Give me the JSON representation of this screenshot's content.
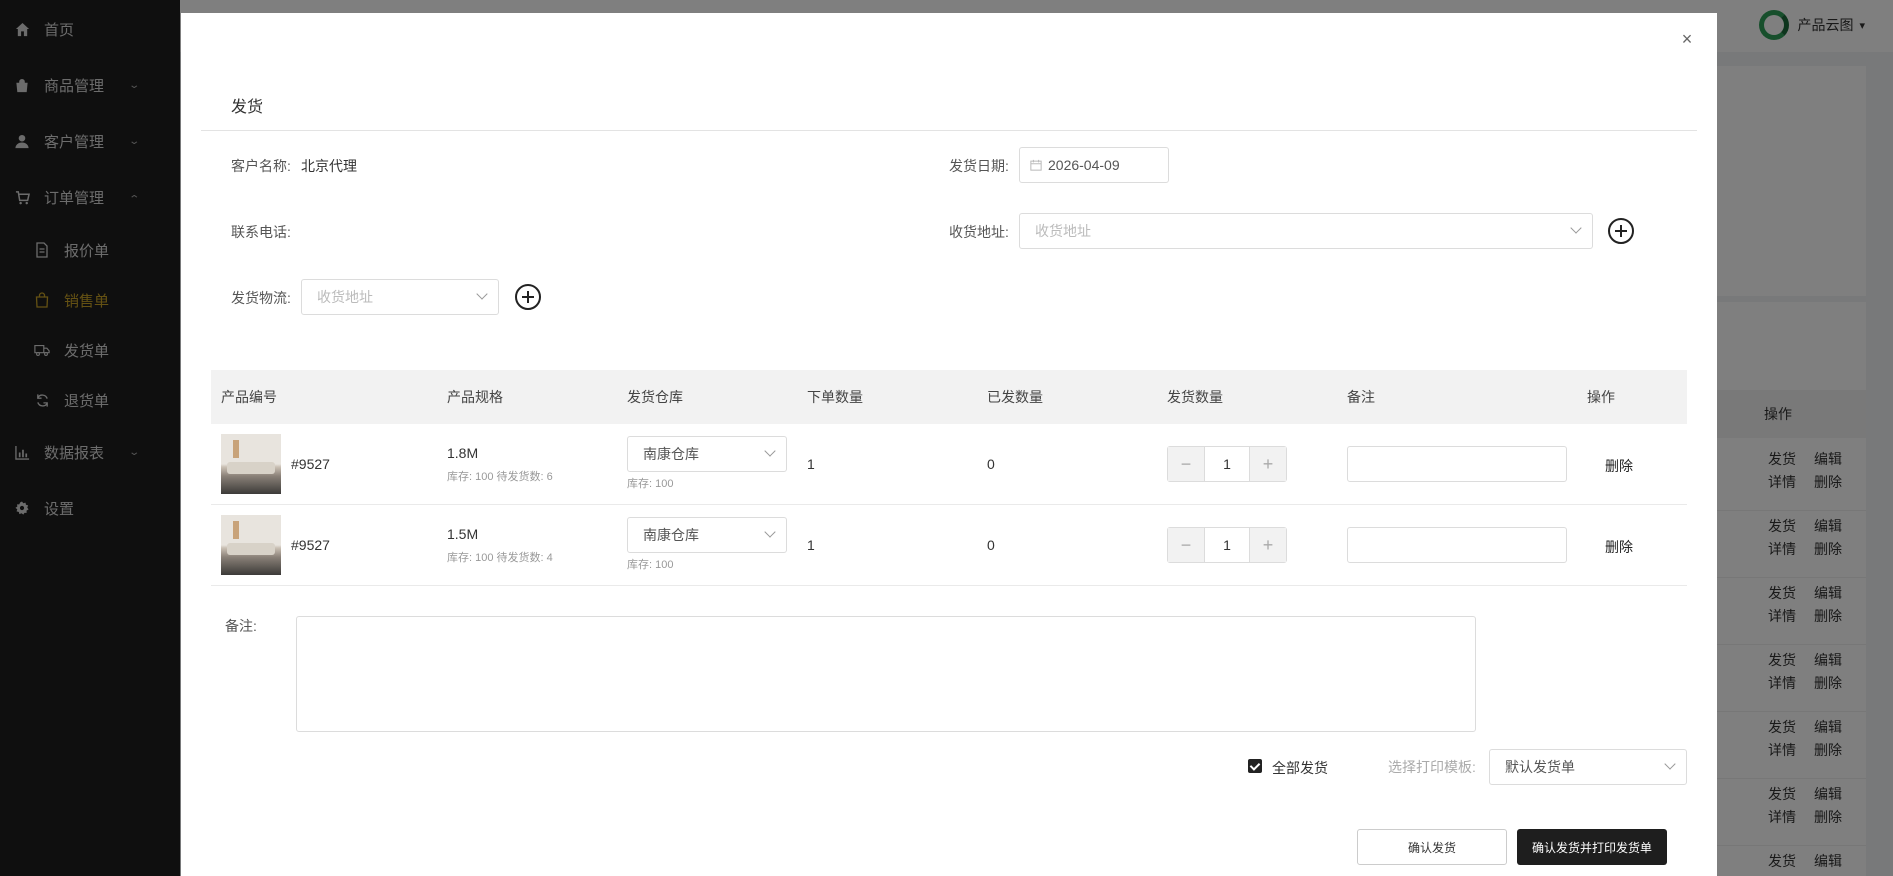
{
  "sidebar": {
    "items": [
      {
        "label": "首页",
        "icon": "home-icon"
      },
      {
        "label": "商品管理",
        "icon": "bag-icon"
      },
      {
        "label": "客户管理",
        "icon": "user-icon"
      },
      {
        "label": "订单管理",
        "icon": "cart-icon"
      },
      {
        "label": "报价单",
        "icon": "document-icon"
      },
      {
        "label": "销售单",
        "icon": "shopping-bag-icon",
        "active": true
      },
      {
        "label": "发货单",
        "icon": "truck-icon"
      },
      {
        "label": "退货单",
        "icon": "refresh-icon"
      },
      {
        "label": "数据报表",
        "icon": "bar-chart-icon"
      },
      {
        "label": "设置",
        "icon": "gear-icon"
      }
    ]
  },
  "topbar": {
    "brand": "产品云图",
    "brand_caret": "▾"
  },
  "background_table": {
    "header": "操作",
    "row_actions": [
      "发货",
      "编辑",
      "详情",
      "删除"
    ]
  },
  "modal": {
    "close": "×",
    "title": "发货",
    "form": {
      "customer_label": "客户名称:",
      "customer_value": "北京代理",
      "date_label": "发货日期:",
      "date_value": "2026-04-09",
      "phone_label": "联系电话:",
      "address_label": "收货地址:",
      "address_placeholder": "收货地址",
      "logistics_label": "发货物流:",
      "logistics_placeholder": "收货地址"
    },
    "table": {
      "columns": [
        "产品编号",
        "产品规格",
        "发货仓库",
        "下单数量",
        "已发数量",
        "发货数量",
        "备注",
        "操作"
      ],
      "rows": [
        {
          "code": "#9527",
          "spec": "1.8M",
          "spec_sub": "库存: 100  待发货数: 6",
          "warehouse": "南康仓库",
          "warehouse_sub": "库存:  100",
          "ordered": "1",
          "shipped": "0",
          "qty": "1",
          "action": "删除"
        },
        {
          "code": "#9527",
          "spec": "1.5M",
          "spec_sub": "库存: 100  待发货数: 4",
          "warehouse": "南康仓库",
          "warehouse_sub": "库存:  100",
          "ordered": "1",
          "shipped": "0",
          "qty": "1",
          "action": "删除"
        }
      ]
    },
    "remark_label": "备注:",
    "ship_all_label": "全部发货",
    "print_template_label": "选择打印模板:",
    "print_template_value": "默认发货单",
    "confirm_button": "确认发货",
    "confirm_print_button": "确认发货并打印发货单"
  }
}
